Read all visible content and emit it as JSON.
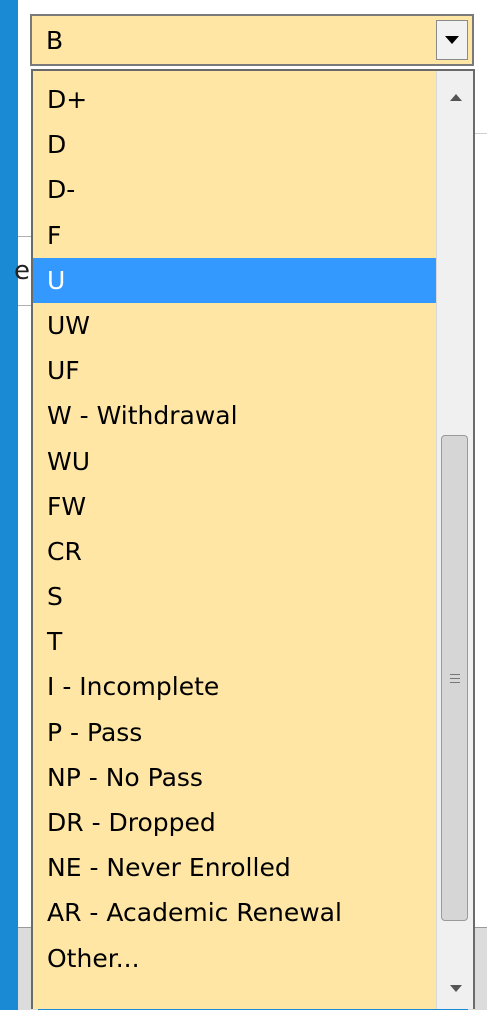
{
  "combo": {
    "selected_value": "B",
    "arrow_icon": "chevron-down-icon"
  },
  "list": {
    "items": [
      {
        "label": "D+"
      },
      {
        "label": "D"
      },
      {
        "label": "D-"
      },
      {
        "label": "F"
      },
      {
        "label": "U",
        "selected": true
      },
      {
        "label": "UW"
      },
      {
        "label": "UF"
      },
      {
        "label": "W - Withdrawal"
      },
      {
        "label": "WU"
      },
      {
        "label": "FW"
      },
      {
        "label": "CR"
      },
      {
        "label": "S"
      },
      {
        "label": "T"
      },
      {
        "label": "I - Incomplete"
      },
      {
        "label": "P - Pass"
      },
      {
        "label": "NP - No Pass"
      },
      {
        "label": "DR - Dropped"
      },
      {
        "label": "NE - Never Enrolled"
      },
      {
        "label": "AR - Academic Renewal"
      },
      {
        "label": "Other..."
      }
    ],
    "highlight_color": "#3399ff",
    "background_color": "#ffe6a4"
  },
  "background": {
    "partial_char": "e"
  }
}
